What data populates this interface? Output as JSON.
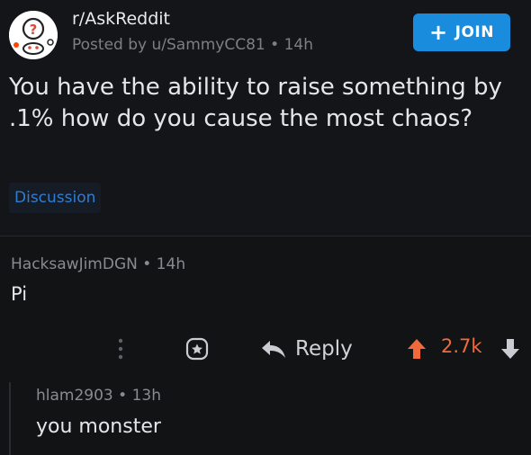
{
  "post": {
    "subreddit": "r/AskReddit",
    "meta": "Posted by u/SammyCC81 • 14h",
    "join_label": "JOIN",
    "join_icon": "+",
    "title": "You have the ability to raise something by .1% how do you cause the most chaos?",
    "flair": "Discussion",
    "avatar_icon": "askreddit-snoo-icon"
  },
  "comment": {
    "meta": "HacksawJimDGN • 14h",
    "body": "Pi",
    "actions": {
      "more_icon": "ellipsis-vertical-icon",
      "award_icon": "award-icon",
      "reply_icon": "reply-arrow-icon",
      "reply_label": "Reply",
      "upvote_icon": "upvote-arrow-icon",
      "score": "2.7k",
      "downvote_icon": "downvote-arrow-icon"
    }
  },
  "reply": {
    "meta": "hlam2903 • 13h",
    "body": "you monster"
  },
  "colors": {
    "background": "#121315",
    "accent": "#1a8cde",
    "upvoted": "#f06a3c",
    "flair_text": "#2f7dd0"
  }
}
